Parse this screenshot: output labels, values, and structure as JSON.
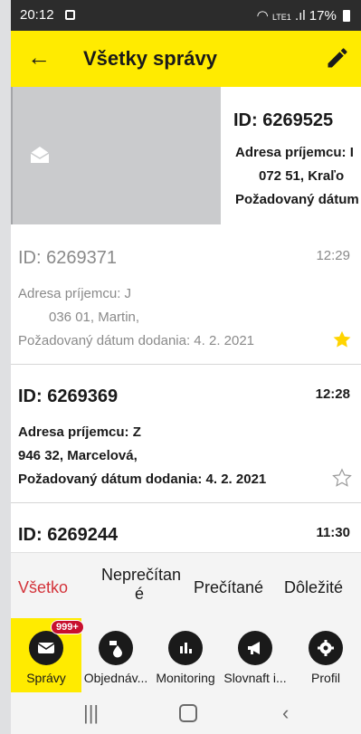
{
  "status_bar": {
    "time": "20:12",
    "network": "LTE1",
    "battery": "17%"
  },
  "app_bar": {
    "title": "Všetky správy"
  },
  "swiped_message": {
    "id": "ID: 6269525",
    "line1": "Adresa príjemcu: I",
    "line2": "072 51, Kraľo",
    "line3": "Požadovaný dátum"
  },
  "messages": [
    {
      "id": "ID: 6269371",
      "time": "12:29",
      "line1": "Adresa príjemcu: J",
      "line2": "036 01, Martin,",
      "line3": "Požadovaný dátum dodania: 4. 2. 2021",
      "starred": true,
      "read": true
    },
    {
      "id": "ID: 6269369",
      "time": "12:28",
      "line1": "Adresa príjemcu: Z",
      "line2": "946 32, Marcelová,",
      "line3": "Požadovaný dátum dodania: 4. 2. 2021",
      "starred": false,
      "read": false
    },
    {
      "id": "ID: 6269244",
      "time": "11:30",
      "read": false
    }
  ],
  "filter_tabs": {
    "all": "Všetko",
    "unread_line1": "Neprečítan",
    "unread_line2": "é",
    "read": "Prečítané",
    "important": "Dôležité"
  },
  "bottom_nav": {
    "messages": "Správy",
    "messages_badge": "999+",
    "orders": "Objednáv...",
    "monitoring": "Monitoring",
    "slovnaft": "Slovnaft i...",
    "profile": "Profil"
  },
  "colors": {
    "accent": "#ffeb00",
    "active_tab": "#d3333a",
    "star": "#ffd400"
  }
}
